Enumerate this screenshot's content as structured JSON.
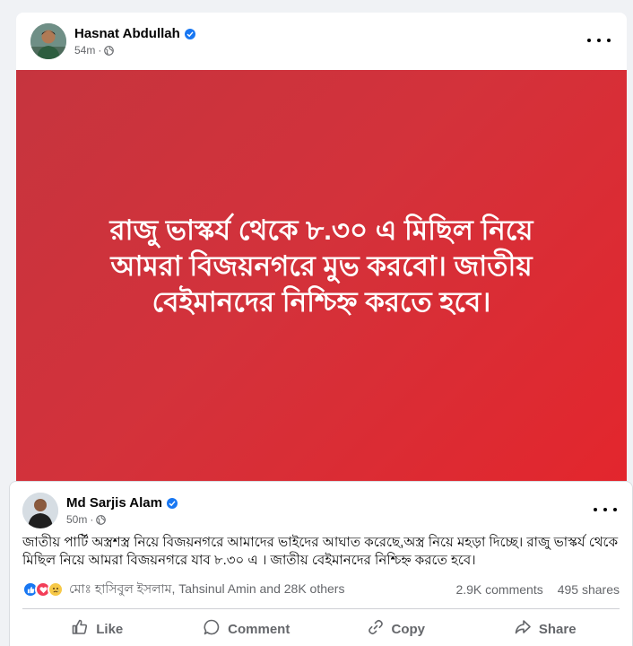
{
  "post1": {
    "author": "Hasnat Abdullah",
    "time": "54m",
    "separator": "·",
    "banner_text": "রাজু ভাস্কর্য থেকে ৮.৩০ এ মিছিল নিয়ে আমরা বিজয়নগরে মুভ করবো। জাতীয় বেইমানদের নিশ্চিহ্ন করতে হবে।",
    "banner_colors": [
      "#c6343e",
      "#e3262d"
    ]
  },
  "post2": {
    "author": "Md Sarjis Alam",
    "time": "50m",
    "separator": "·",
    "caption": "জাতীয় পার্টি অস্ত্রশস্ত্র নিয়ে বিজয়নগরে আমাদের ভাইদের আঘাত করেছে,অস্ত্র নিয়ে মহড়া দিচ্ছে। রাজু ভাস্কর্য থেকে মিছিল নিয়ে আমরা বিজয়নগরে যাব ৮.৩০ এ । জাতীয় বেইমানদের নিশ্চিহ্ন করতে হবে।",
    "reactions_text": "মোঃ হাসিবুল ইসলাম, Tahsinul Amin and 28K others",
    "comments": "2.9K comments",
    "shares": "495 shares",
    "actions": {
      "like": "Like",
      "comment": "Comment",
      "copy": "Copy",
      "share": "Share"
    }
  },
  "icons": [
    "verified-badge-icon",
    "globe-icon",
    "more-options-icon",
    "like-reaction-icon",
    "love-reaction-icon",
    "sad-reaction-icon",
    "thumbs-up-icon",
    "comment-bubble-icon",
    "copy-link-icon",
    "share-arrow-icon"
  ],
  "colors": {
    "accent": "#1877f2",
    "text_secondary": "#65676b",
    "background": "#f0f2f5"
  }
}
